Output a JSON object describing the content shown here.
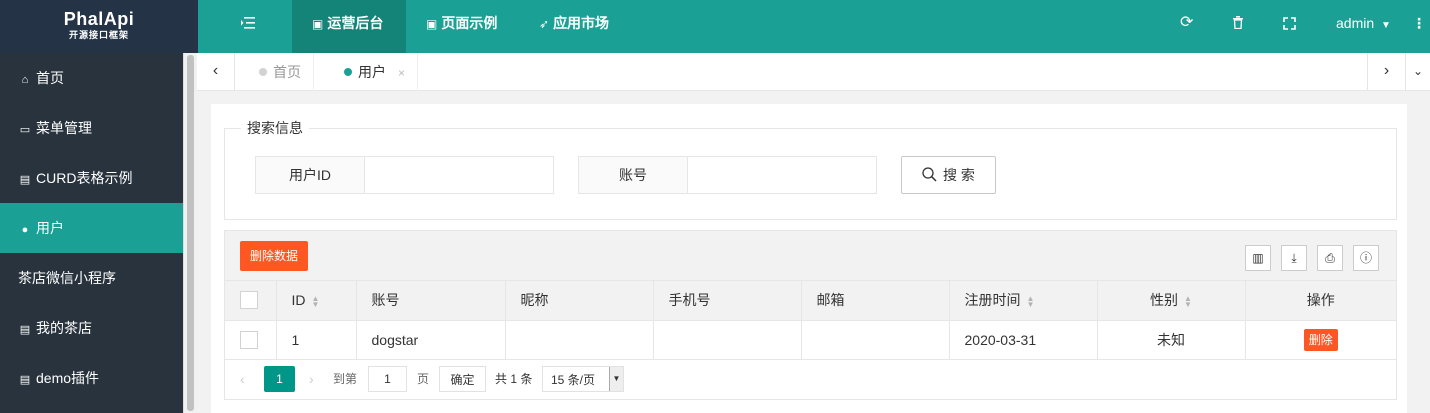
{
  "logo": {
    "line1": "PhalApi",
    "line2": "开源接口框架"
  },
  "header": {
    "menu_icon": "list-icon",
    "nav": [
      {
        "label": "运营后台",
        "icon": "user-card-icon"
      },
      {
        "label": "页面示例",
        "icon": "id-badge-icon"
      },
      {
        "label": "应用市场",
        "icon": "rocket-icon"
      }
    ],
    "right_icons": [
      "refresh-icon",
      "trash-icon",
      "fullscreen-icon"
    ],
    "user": "admin",
    "more_icon": "more-vertical-icon"
  },
  "sidebar": {
    "items": [
      {
        "label": "首页",
        "icon": "home-icon"
      },
      {
        "label": "菜单管理",
        "icon": "window-icon"
      },
      {
        "label": "CURD表格示例",
        "icon": "table-icon"
      },
      {
        "label": "用户",
        "icon": "users-icon"
      },
      {
        "label": "茶店微信小程序",
        "icon": ""
      },
      {
        "label": "我的茶店",
        "icon": "table-icon"
      },
      {
        "label": "demo插件",
        "icon": "table-icon"
      }
    ],
    "active_index": 3
  },
  "tabs": [
    {
      "label": "首页"
    },
    {
      "label": "用户",
      "close": "×"
    }
  ],
  "search": {
    "legend": "搜索信息",
    "fields": [
      {
        "label": "用户ID",
        "value": ""
      },
      {
        "label": "账号",
        "value": ""
      }
    ],
    "button": "搜 索"
  },
  "table": {
    "delete_button": "删除数据",
    "tool_icons": [
      "columns-icon",
      "export-icon",
      "print-icon",
      "info-icon"
    ],
    "columns": [
      "ID",
      "账号",
      "昵称",
      "手机号",
      "邮箱",
      "注册时间",
      "性别",
      "操作"
    ],
    "rows": [
      {
        "id": "1",
        "account": "dogstar",
        "nickname": "",
        "phone": "",
        "email": "",
        "reg_time": "2020-03-31",
        "gender": "未知",
        "action": "删除"
      }
    ]
  },
  "pager": {
    "current": "1",
    "goto_label": "到第",
    "page_input": "1",
    "page_unit": "页",
    "confirm": "确定",
    "total": "共 1 条",
    "per_page": "15 条/页"
  },
  "colors": {
    "primary": "#1aa094",
    "sidebar": "#28333e",
    "danger": "#ff5722",
    "pager": "#009688"
  }
}
